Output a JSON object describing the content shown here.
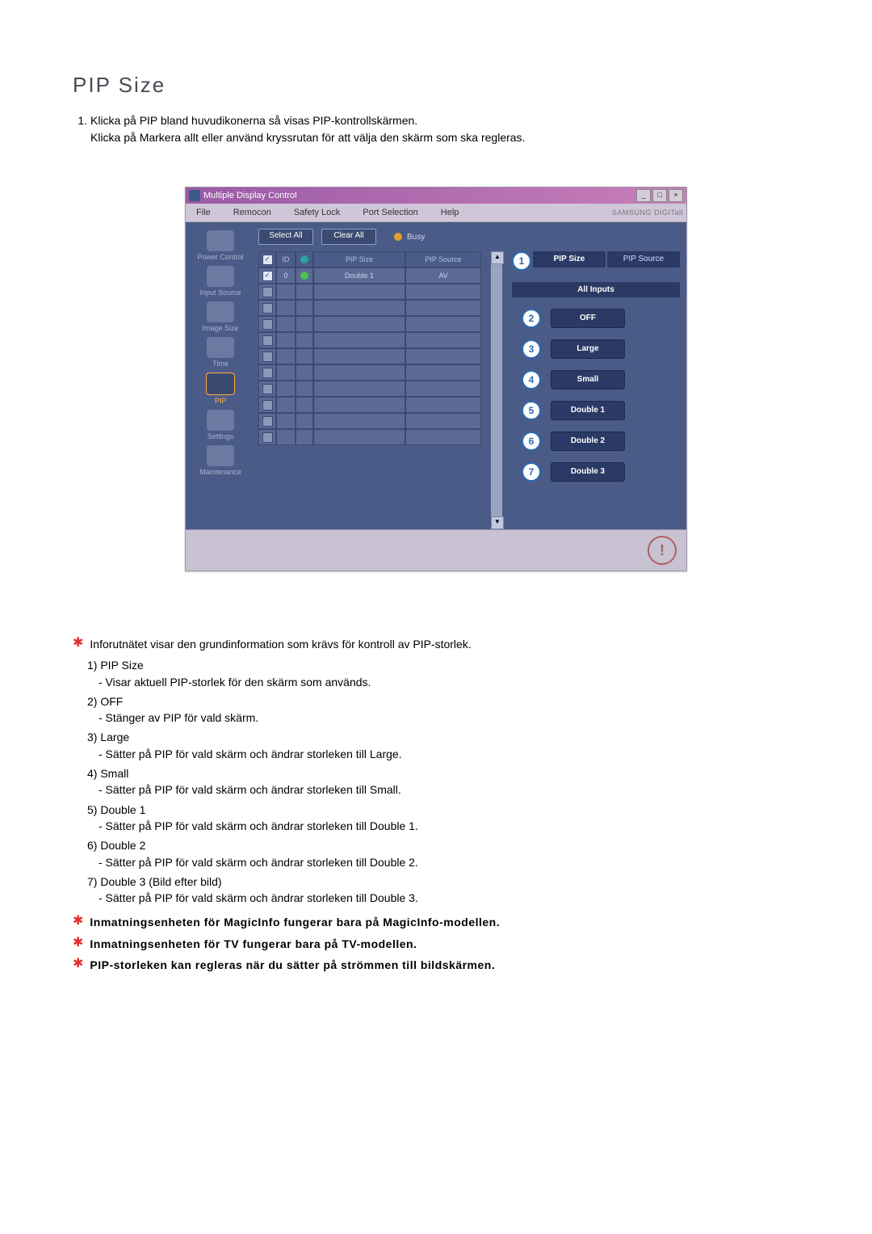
{
  "heading": "PIP Size",
  "intro": [
    "Klicka på PIP bland huvudikonerna så visas PIP-kontrollskärmen.",
    "Klicka på Markera allt eller använd kryssrutan för att välja den skärm som ska regleras."
  ],
  "window": {
    "title": "Multiple Display Control",
    "win_min": "_",
    "win_max": "□",
    "win_close": "×",
    "menu": [
      "File",
      "Remocon",
      "Safety Lock",
      "Port Selection",
      "Help"
    ],
    "brand": "SAMSUNG DIGITall"
  },
  "sidebar": {
    "items": [
      {
        "label": "Power Control"
      },
      {
        "label": "Input Source"
      },
      {
        "label": "Image Size"
      },
      {
        "label": "Time"
      },
      {
        "label": "PIP"
      },
      {
        "label": "Settings"
      },
      {
        "label": "Maintenance"
      }
    ]
  },
  "toolbar": {
    "select_all": "Select All",
    "clear_all": "Clear All",
    "busy": "Busy"
  },
  "grid": {
    "headers": {
      "chk": "✓",
      "id": "ID",
      "size": "PIP Size",
      "source": "PIP Source"
    },
    "rows": [
      {
        "checked": true,
        "id": "0",
        "dot": "green",
        "size": "Double 1",
        "source": "AV"
      },
      {
        "checked": false
      },
      {
        "checked": false
      },
      {
        "checked": false
      },
      {
        "checked": false
      },
      {
        "checked": false
      },
      {
        "checked": false
      },
      {
        "checked": false
      },
      {
        "checked": false
      },
      {
        "checked": false
      },
      {
        "checked": false
      }
    ]
  },
  "right_panel": {
    "tab_size": "PIP Size",
    "tab_source": "PIP Source",
    "all_inputs": "All Inputs",
    "options": [
      {
        "n": "2",
        "label": "OFF"
      },
      {
        "n": "3",
        "label": "Large"
      },
      {
        "n": "4",
        "label": "Small"
      },
      {
        "n": "5",
        "label": "Double 1"
      },
      {
        "n": "6",
        "label": "Double 2"
      },
      {
        "n": "7",
        "label": "Double 3"
      }
    ],
    "callout_tabs": "1"
  },
  "notes": {
    "star1": "Inforutnätet visar den grundinformation som krävs för kontroll av PIP-storlek.",
    "items": [
      {
        "n": "1)",
        "t": "PIP Size",
        "d": "- Visar aktuell PIP-storlek för den skärm som används."
      },
      {
        "n": "2)",
        "t": "OFF",
        "d": "- Stänger av PIP för vald skärm."
      },
      {
        "n": "3)",
        "t": "Large",
        "d": "- Sätter på PIP för vald skärm och ändrar storleken till Large."
      },
      {
        "n": "4)",
        "t": "Small",
        "d": "- Sätter på PIP för vald skärm och ändrar storleken till Small."
      },
      {
        "n": "5)",
        "t": "Double 1",
        "d": "- Sätter på PIP för vald skärm och ändrar storleken till Double 1."
      },
      {
        "n": "6)",
        "t": "Double 2",
        "d": "- Sätter på PIP för vald skärm och ändrar storleken till Double 2."
      },
      {
        "n": "7)",
        "t": "Double 3 (Bild efter bild)",
        "d": "- Sätter på PIP för vald skärm och ändrar storleken till Double 3."
      }
    ],
    "star2": "Inmatningsenheten för MagicInfo fungerar bara på MagicInfo-modellen.",
    "star3": "Inmatningsenheten för TV fungerar bara på TV-modellen.",
    "star4": "PIP-storleken kan regleras när du sätter på strömmen till bildskärmen."
  }
}
